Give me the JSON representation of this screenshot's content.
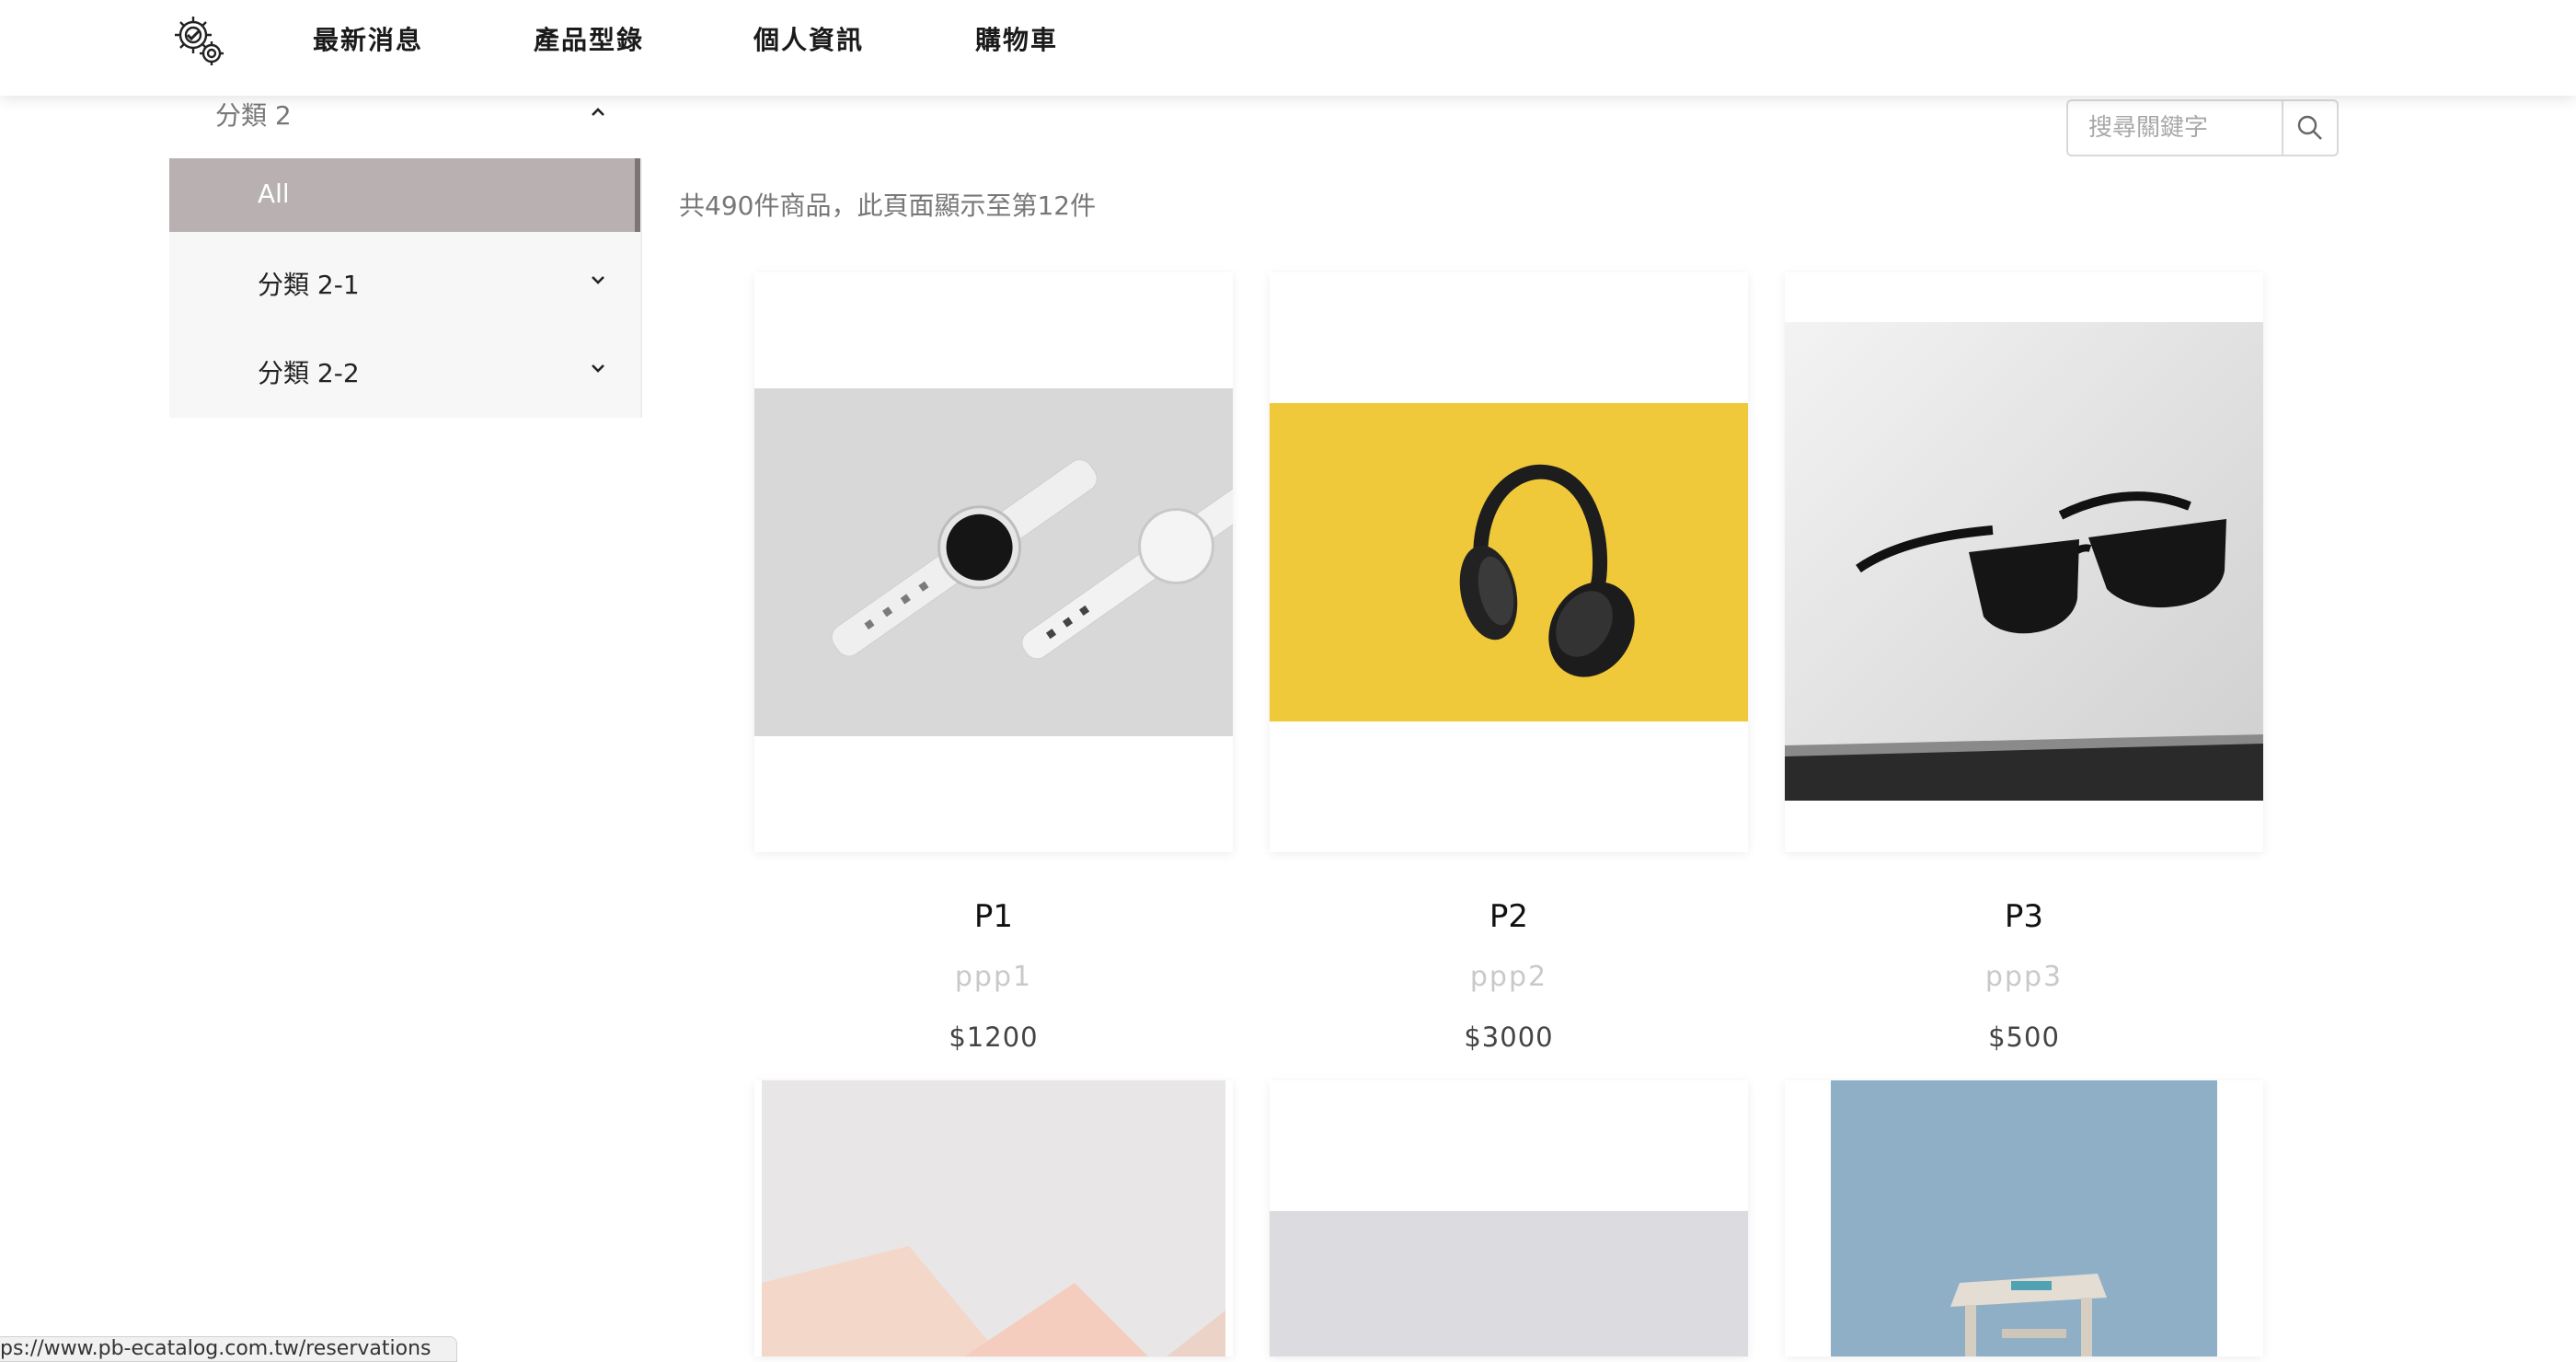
{
  "nav": {
    "logo_icon": "gears-icon",
    "items": [
      "最新消息",
      "產品型錄",
      "個人資訊",
      "購物車"
    ]
  },
  "sidebar": {
    "category": "分類 2",
    "all_label": "All",
    "subcategories": [
      "分類 2-1",
      "分類 2-2"
    ]
  },
  "search": {
    "placeholder": "搜尋關鍵字",
    "icon": "search-icon"
  },
  "results": {
    "summary": "共490件商品，此頁面顯示至第12件"
  },
  "products": [
    {
      "name": "P1",
      "sub": "ppp1",
      "price": "$1200",
      "image": "white-smartwatches"
    },
    {
      "name": "P2",
      "sub": "ppp2",
      "price": "$3000",
      "image": "black-headphones-on-yellow"
    },
    {
      "name": "P3",
      "sub": "ppp3",
      "price": "$500",
      "image": "black-sunglasses"
    },
    {
      "name": "",
      "sub": "",
      "price": "",
      "image": "pastel-paper-shapes"
    },
    {
      "name": "",
      "sub": "",
      "price": "",
      "image": "grey-product"
    },
    {
      "name": "",
      "sub": "",
      "price": "",
      "image": "wooden-stool-on-blue"
    }
  ],
  "status_bar": {
    "url": "ps://www.pb-ecatalog.com.tw/reservations"
  },
  "colors": {
    "active_category_bg": "#b9b1b1",
    "active_category_border": "#7d7575",
    "subpanel_bg": "#f7f7f7",
    "product_sub_text": "#c9c9c9"
  }
}
